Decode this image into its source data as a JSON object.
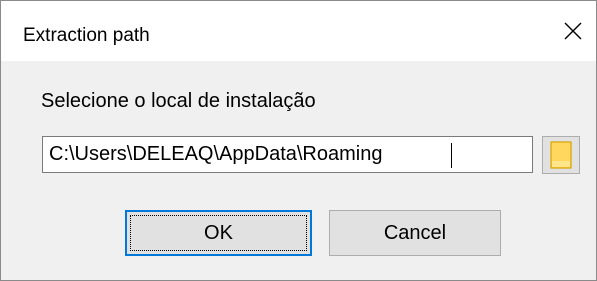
{
  "window": {
    "title": "Extraction path"
  },
  "dialog": {
    "prompt": "Selecione o local de instalação",
    "path_value": "C:\\Users\\DELEAQ\\AppData\\Roaming",
    "ok_label": "OK",
    "cancel_label": "Cancel"
  },
  "icons": {
    "close": "close-icon",
    "browse": "folder-icon"
  },
  "colors": {
    "focus_border": "#0078d7",
    "folder_fill": "#ffd75e",
    "folder_stroke": "#d9a400"
  }
}
